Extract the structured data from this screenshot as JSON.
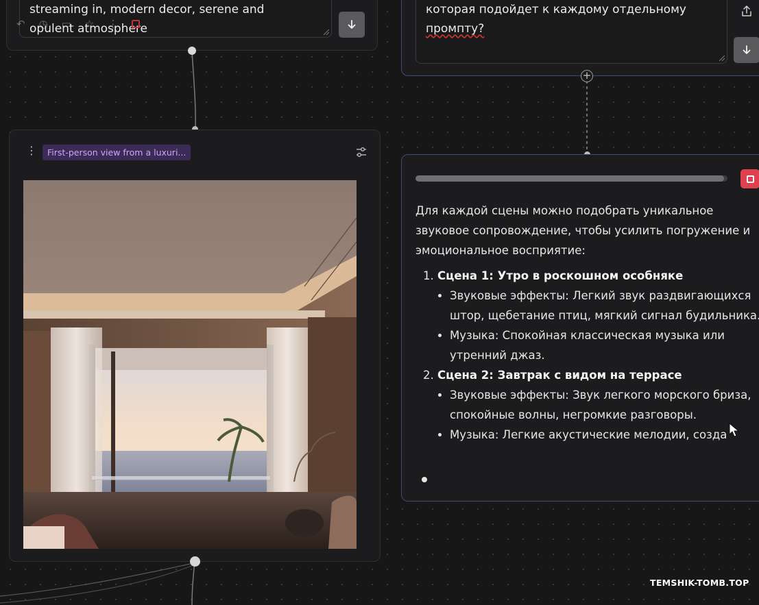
{
  "prompt_node": {
    "text_line1": "streaming in, modern decor, serene and",
    "text_line2": "opulent atmosphere",
    "submit_icon": "arrow-down-icon"
  },
  "question_node": {
    "text_line1": "которая подойдет к каждому отдельному",
    "text_line2": "промпту?",
    "submit_icon": "arrow-down-icon",
    "share_icon": "share-icon"
  },
  "image_node": {
    "title": "First-person view from a luxuri...",
    "menu_icon": "kebab-menu-icon",
    "settings_icon": "sliders-icon"
  },
  "response_node": {
    "progress": 0.99,
    "intro": "Для каждой сцены можно подобрать уникальное звуковое сопровождение, чтобы усилить погружение и эмоциональное восприятие:",
    "scenes": [
      {
        "title": "Сцена 1: Утро в роскошном особняке",
        "items": [
          "Звуковые эффекты: Легкий звук раздвигающихся штор, щебетание птиц, мягкий сигнал будильника.",
          "Музыка: Спокойная классическая музыка или утренний джаз."
        ]
      },
      {
        "title": "Сцена 2: Завтрак с видом на террасе",
        "items": [
          "Звуковые эффекты: Звук легкого морского бриза, спокойные волны, негромкие разговоры.",
          "Музыка: Легкие акустические мелодии, созда"
        ]
      }
    ]
  },
  "watermark": "TEMSHIK-TOMB.TOP",
  "colors": {
    "canvas": "#171717",
    "accent_stop": "#e0414f",
    "title_pill": "#3c2a57",
    "title_text": "#c9a9f5",
    "selected_border": "#3b4a78"
  }
}
